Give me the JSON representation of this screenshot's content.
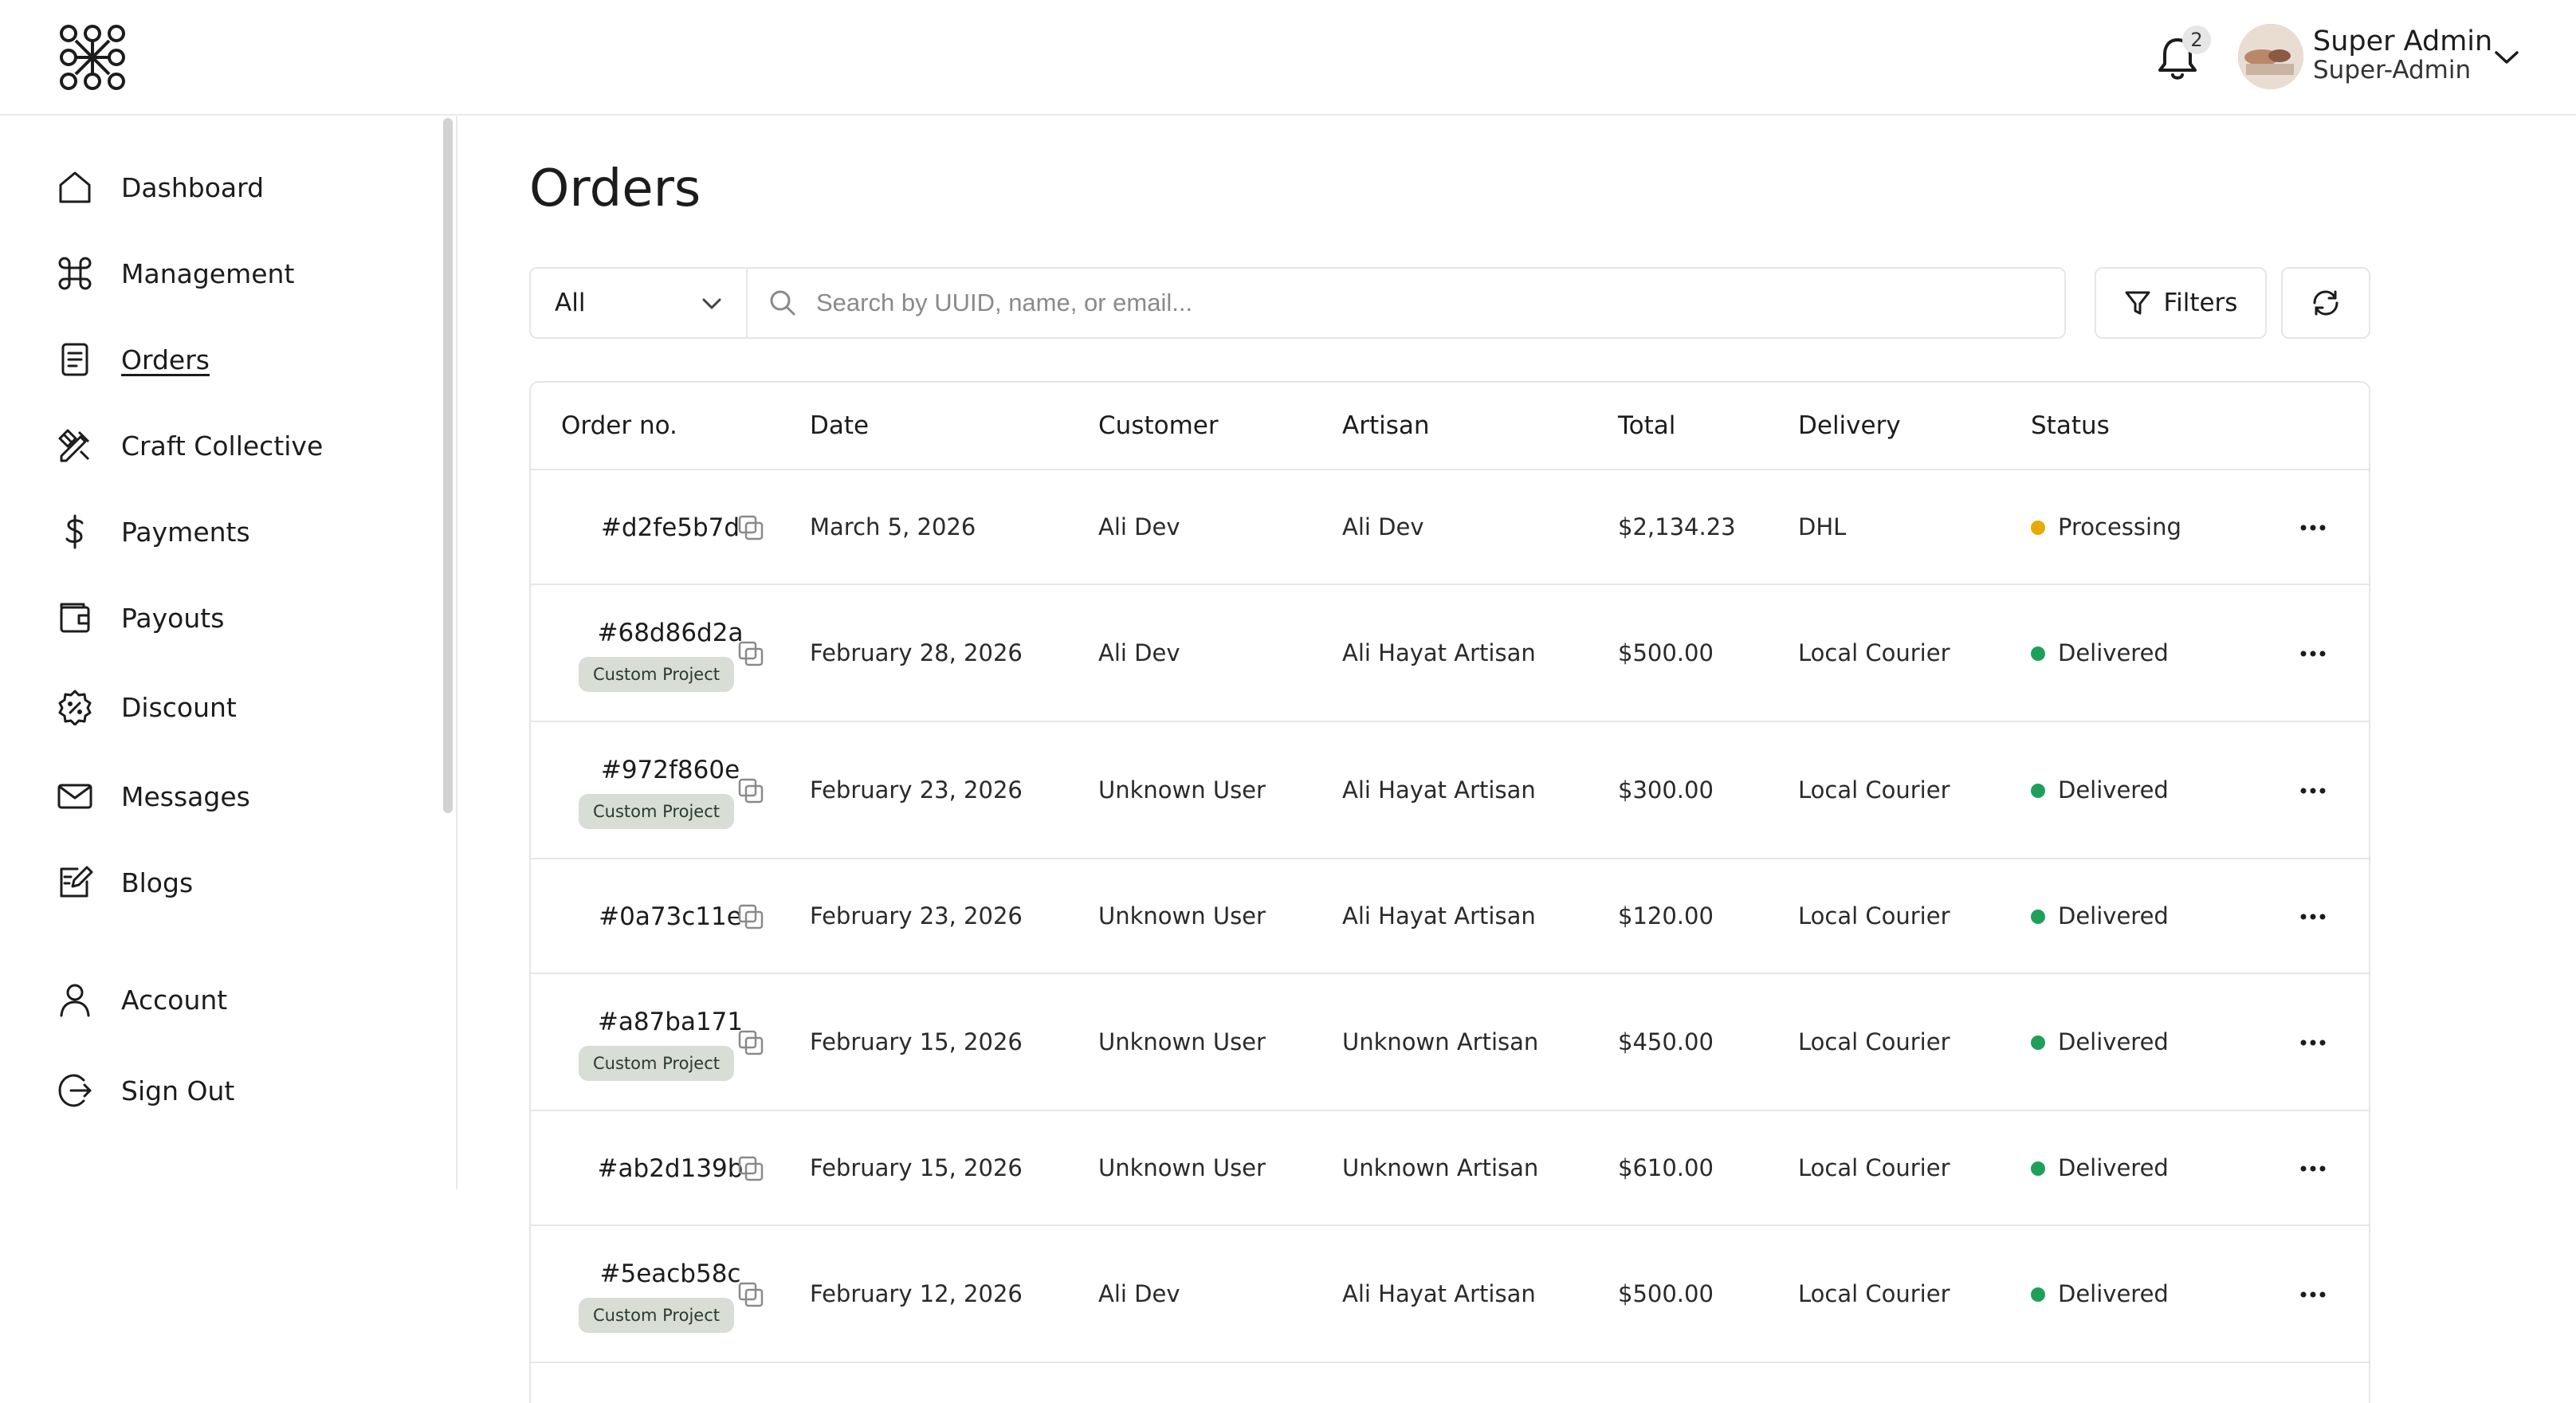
{
  "header": {
    "notification_count": "2",
    "user_name": "Super Admin",
    "user_role": "Super-Admin"
  },
  "sidebar": {
    "items": [
      {
        "label": "Dashboard",
        "icon": "home-icon"
      },
      {
        "label": "Management",
        "icon": "command-icon"
      },
      {
        "label": "Orders",
        "icon": "document-icon",
        "active": true
      },
      {
        "label": "Craft Collective",
        "icon": "tools-icon"
      },
      {
        "label": "Payments",
        "icon": "dollar-icon"
      },
      {
        "label": "Payouts",
        "icon": "wallet-icon"
      },
      {
        "label": "Discount",
        "icon": "discount-badge-icon"
      },
      {
        "label": "Messages",
        "icon": "mail-icon"
      },
      {
        "label": "Blogs",
        "icon": "edit-icon"
      }
    ],
    "bottom_items": [
      {
        "label": "Account",
        "icon": "user-icon"
      },
      {
        "label": "Sign Out",
        "icon": "sign-out-icon"
      }
    ]
  },
  "main": {
    "title": "Orders",
    "filter_value": "All",
    "search_placeholder": "Search by UUID, name, or email...",
    "filters_label": "Filters"
  },
  "table": {
    "columns": [
      "Order no.",
      "Date",
      "Customer",
      "Artisan",
      "Total",
      "Delivery",
      "Status"
    ],
    "rows": [
      {
        "id": "#d2fe5b7d",
        "tag": "",
        "date": "March 5, 2026",
        "customer": "Ali Dev",
        "artisan": "Ali Dev",
        "total": "$2,134.23",
        "delivery": "DHL",
        "status": "Processing",
        "status_color": "#e8a900"
      },
      {
        "id": "#68d86d2a",
        "tag": "Custom Project",
        "date": "February 28, 2026",
        "customer": "Ali Dev",
        "artisan": "Ali Hayat Artisan",
        "total": "$500.00",
        "delivery": "Local Courier",
        "status": "Delivered",
        "status_color": "#1ea05a"
      },
      {
        "id": "#972f860e",
        "tag": "Custom Project",
        "date": "February 23, 2026",
        "customer": "Unknown User",
        "artisan": "Ali Hayat Artisan",
        "total": "$300.00",
        "delivery": "Local Courier",
        "status": "Delivered",
        "status_color": "#1ea05a"
      },
      {
        "id": "#0a73c11e",
        "tag": "",
        "date": "February 23, 2026",
        "customer": "Unknown User",
        "artisan": "Ali Hayat Artisan",
        "total": "$120.00",
        "delivery": "Local Courier",
        "status": "Delivered",
        "status_color": "#1ea05a"
      },
      {
        "id": "#a87ba171",
        "tag": "Custom Project",
        "date": "February 15, 2026",
        "customer": "Unknown User",
        "artisan": "Unknown Artisan",
        "total": "$450.00",
        "delivery": "Local Courier",
        "status": "Delivered",
        "status_color": "#1ea05a"
      },
      {
        "id": "#ab2d139b",
        "tag": "",
        "date": "February 15, 2026",
        "customer": "Unknown User",
        "artisan": "Unknown Artisan",
        "total": "$610.00",
        "delivery": "Local Courier",
        "status": "Delivered",
        "status_color": "#1ea05a"
      },
      {
        "id": "#5eacb58c",
        "tag": "Custom Project",
        "date": "February 12, 2026",
        "customer": "Ali Dev",
        "artisan": "Ali Hayat Artisan",
        "total": "$500.00",
        "delivery": "Local Courier",
        "status": "Delivered",
        "status_color": "#1ea05a"
      }
    ]
  }
}
